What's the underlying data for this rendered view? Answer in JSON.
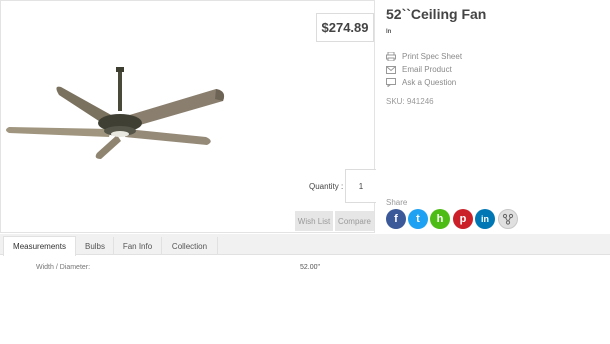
{
  "product": {
    "price": "$274.89",
    "title": "52``Ceiling Fan",
    "brand": "In",
    "sku_label": "SKU:",
    "sku_value": "941246"
  },
  "purchase": {
    "quantity_label": "Quantity :",
    "quantity_value": "1",
    "wishlist_label": "Wish List",
    "compare_label": "Compare"
  },
  "actions": [
    {
      "label": "Print Spec Sheet",
      "icon": "printer-icon"
    },
    {
      "label": "Email Product",
      "icon": "envelope-icon"
    },
    {
      "label": "Ask a Question",
      "icon": "chat-bubble-icon"
    }
  ],
  "share": {
    "label": "Share",
    "networks": [
      {
        "name": "facebook",
        "glyph": "f",
        "color": "#3b5998",
        "icon": "facebook-icon"
      },
      {
        "name": "twitter",
        "glyph": "t",
        "color": "#1da1f2",
        "icon": "twitter-icon"
      },
      {
        "name": "houzz",
        "glyph": "h",
        "color": "#4dbc15",
        "icon": "houzz-icon"
      },
      {
        "name": "pinterest",
        "glyph": "p",
        "color": "#cb2027",
        "icon": "pinterest-icon"
      },
      {
        "name": "linkedin",
        "glyph": "in",
        "color": "#0077b5",
        "icon": "linkedin-icon"
      },
      {
        "name": "more",
        "glyph": "",
        "color": "#e0e0e0",
        "icon": "share-branch-icon"
      }
    ]
  },
  "tabs": [
    {
      "label": "Measurements",
      "active": true
    },
    {
      "label": "Bulbs",
      "active": false
    },
    {
      "label": "Fan Info",
      "active": false
    },
    {
      "label": "Collection",
      "active": false
    }
  ],
  "specs": [
    {
      "label": "Width / Diameter:",
      "value": "52.00\""
    }
  ]
}
